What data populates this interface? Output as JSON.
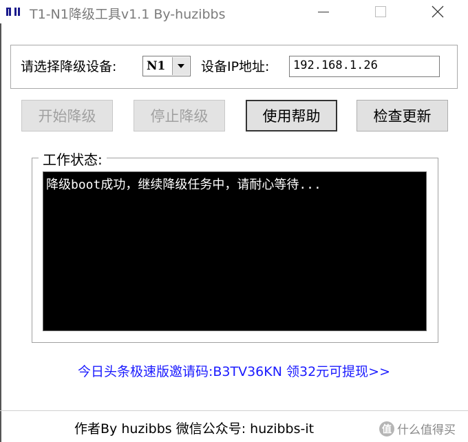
{
  "window": {
    "title": "T1-N1降级工具v1.1 By-huzibbs"
  },
  "device_panel": {
    "device_label": "请选择降级设备:",
    "device_value": "N1",
    "ip_label": "设备IP地址:",
    "ip_value": "192.168.1.26"
  },
  "buttons": {
    "start": "开始降级",
    "stop": "停止降级",
    "help": "使用帮助",
    "update": "检查更新"
  },
  "status": {
    "title": "工作状态:",
    "message": "降级boot成功，继续降级任务中，请耐心等待..."
  },
  "promo_link": "今日头条极速版邀请码:B3TV36KN 领32元可提现>>",
  "footer": "作者By huzibbs 微信公众号: huzibbs-it",
  "watermark": {
    "logo_char": "值",
    "text": "什么值得买"
  }
}
